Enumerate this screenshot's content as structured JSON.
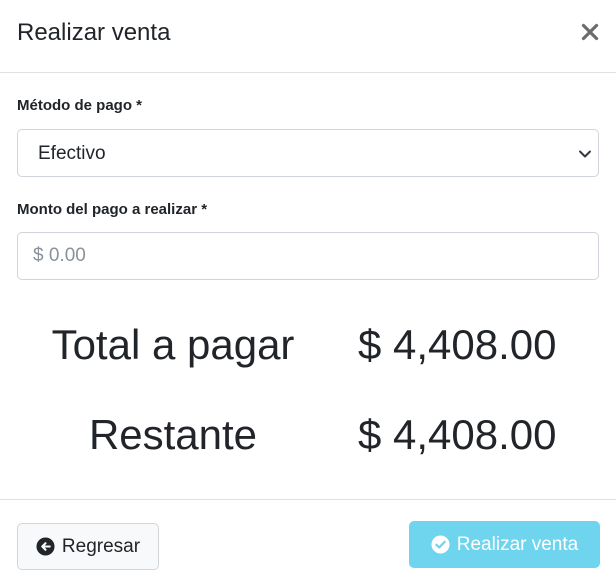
{
  "header": {
    "title": "Realizar venta",
    "close_icon": "close-icon"
  },
  "form": {
    "payment_method_label": "Método de pago *",
    "payment_method_value": "Efectivo",
    "amount_label": "Monto del pago a realizar *",
    "amount_placeholder": "$ 0.00",
    "amount_value": ""
  },
  "summary": {
    "total_label": "Total a pagar",
    "total_value": "$ 4,408.00",
    "remaining_label": "Restante",
    "remaining_value": "$ 4,408.00"
  },
  "footer": {
    "back_label": "Regresar",
    "back_icon": "arrow-left-circle-icon",
    "submit_label": "Realizar venta",
    "submit_icon": "check-circle-icon"
  },
  "colors": {
    "submit_bg": "#6fd5ef",
    "border": "#ced4da",
    "divider": "#dee2e6"
  }
}
